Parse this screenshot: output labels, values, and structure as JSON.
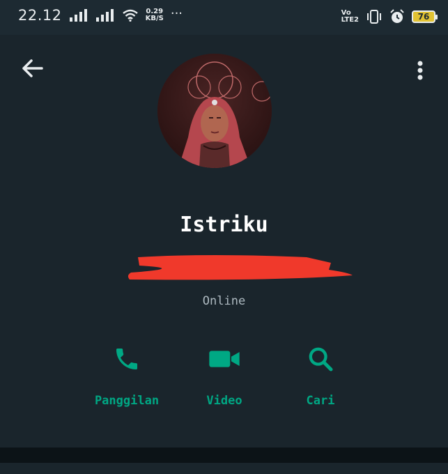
{
  "status_bar": {
    "time": "22.12",
    "net_speed_value": "0.29",
    "net_speed_unit": "KB/S",
    "more": "···",
    "volte_line1": "Vo",
    "volte_line2": "LTE2",
    "battery_level": "76"
  },
  "contact": {
    "name": "Istriku",
    "status": "Online"
  },
  "actions": {
    "call_label": "Panggilan",
    "video_label": "Video",
    "search_label": "Cari"
  },
  "colors": {
    "accent": "#00a884",
    "background": "#1a252c",
    "redaction": "#f0392b"
  }
}
